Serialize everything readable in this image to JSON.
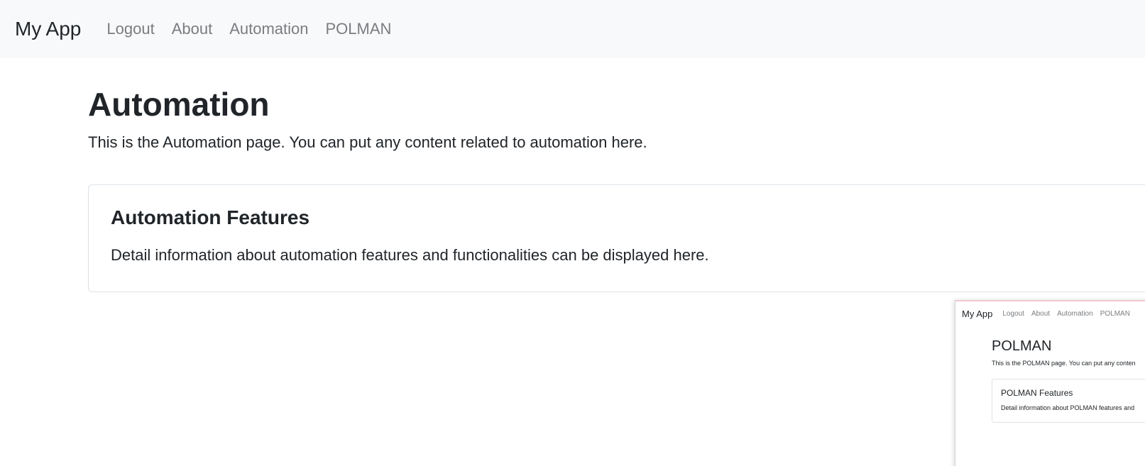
{
  "navbar": {
    "brand": "My App",
    "links": [
      "Logout",
      "About",
      "Automation",
      "POLMAN"
    ]
  },
  "main": {
    "title": "Automation",
    "intro": "This is the Automation page. You can put any content related to automation here."
  },
  "card": {
    "title": "Automation Features",
    "text": "Detail information about automation features and functionalities can be displayed here."
  },
  "thumbnail": {
    "brand": "My App",
    "links": [
      "Logout",
      "About",
      "Automation",
      "POLMAN"
    ],
    "title": "POLMAN",
    "intro": "This is the POLMAN page. You can put any conten",
    "card_title": "POLMAN Features",
    "card_text": "Detail information about POLMAN features and"
  },
  "colors": {
    "navbar_bg": "#f8f9fa",
    "nav_link": "#7a7d80",
    "text": "#212529",
    "card_border": "#dee2e6"
  }
}
